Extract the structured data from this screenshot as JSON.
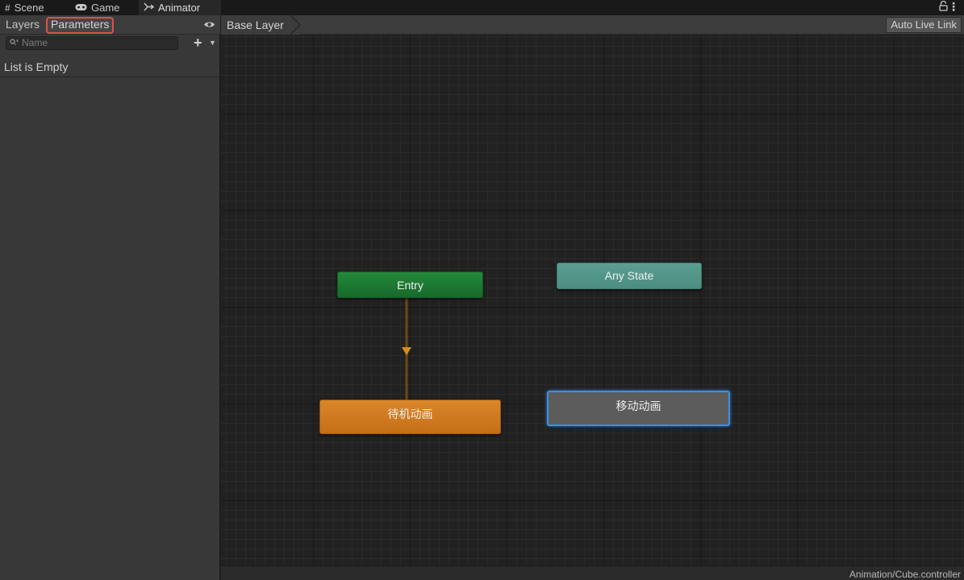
{
  "tabs": {
    "scene": {
      "label": "Scene",
      "icon": "grid-icon"
    },
    "game": {
      "label": "Game",
      "icon": "gamepad-icon"
    },
    "animator": {
      "label": "Animator",
      "icon": "animator-icon"
    }
  },
  "left_panel": {
    "layers_label": "Layers",
    "parameters_label": "Parameters",
    "search": {
      "placeholder": "Name",
      "value": ""
    },
    "empty_text": "List is Empty"
  },
  "graph": {
    "breadcrumb": "Base Layer",
    "auto_live_link": "Auto Live Link",
    "states": {
      "entry": "Entry",
      "any_state": "Any State",
      "idle": "待机动画",
      "move": "移动动画"
    }
  },
  "status": {
    "controller_path": "Animation/Cube.controller"
  },
  "colors": {
    "entry": "#1f7d35",
    "any_state": "#549a8d",
    "default_state": "#d27c21",
    "selected_outline": "#3f8ee0",
    "highlight": "#e0504a"
  }
}
